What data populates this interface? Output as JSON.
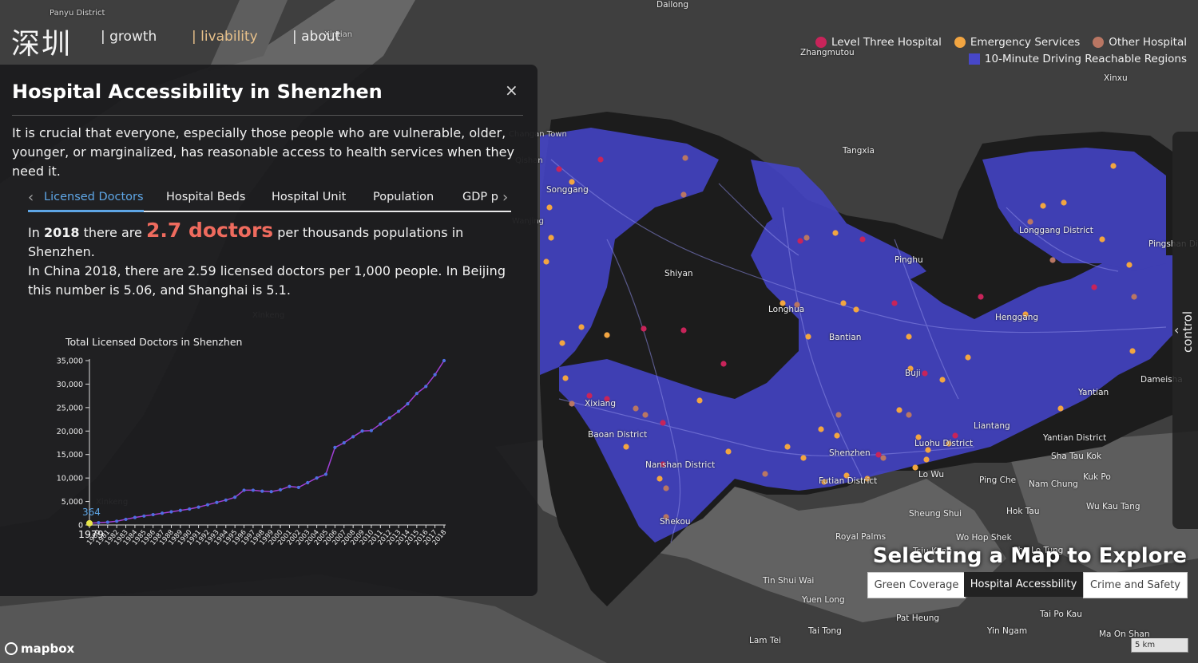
{
  "nav": {
    "logo": "深圳",
    "items": [
      {
        "label": "| growth",
        "active": false
      },
      {
        "label": "| livability",
        "active": true
      },
      {
        "label": "| about",
        "active": false
      }
    ]
  },
  "legend": {
    "items": [
      {
        "label": "Level Three Hospital",
        "color": "#c8245a"
      },
      {
        "label": "Emergency Services",
        "color": "#f2a541"
      },
      {
        "label": "Other Hospital",
        "color": "#b97663"
      }
    ],
    "region": {
      "label": "10-Minute Driving Reachable Regions",
      "color": "#4747c8"
    }
  },
  "map_labels": [
    {
      "text": "Panyu District"
    },
    {
      "text": "Dailong"
    },
    {
      "text": "Zhangmutou"
    },
    {
      "text": "Xinxu"
    },
    {
      "text": "Tangxia"
    },
    {
      "text": "Songgang"
    },
    {
      "text": "Longgang District"
    },
    {
      "text": "Pingshan Dist"
    },
    {
      "text": "Pinghu"
    },
    {
      "text": "Shiyan"
    },
    {
      "text": "Longhua"
    },
    {
      "text": "Bantian"
    },
    {
      "text": "Henggang"
    },
    {
      "text": "Buji"
    },
    {
      "text": "Yantian"
    },
    {
      "text": "Dameisha"
    },
    {
      "text": "Xixiang"
    },
    {
      "text": "Baoan District"
    },
    {
      "text": "Liantang"
    },
    {
      "text": "Yantian District"
    },
    {
      "text": "Luohu District"
    },
    {
      "text": "Shenzhen"
    },
    {
      "text": "Nanshan District"
    },
    {
      "text": "Sha Tau Kok"
    },
    {
      "text": "Futian District"
    },
    {
      "text": "Lo Wu"
    },
    {
      "text": "Ping Che"
    },
    {
      "text": "Nam Chung"
    },
    {
      "text": "Kuk Po"
    },
    {
      "text": "Shekou"
    },
    {
      "text": "Sheung Shui"
    },
    {
      "text": "Hok Tau"
    },
    {
      "text": "Wu Kau Tang"
    },
    {
      "text": "Royal Palms"
    },
    {
      "text": "Wo Hop Shek"
    },
    {
      "text": "Tsiu Keng"
    },
    {
      "text": "Sha Lo Tung"
    },
    {
      "text": "Tin Shui Wai"
    },
    {
      "text": "Yuen Long"
    },
    {
      "text": "Pat Heung"
    },
    {
      "text": "Tai Po Kau"
    },
    {
      "text": "Tai Tong"
    },
    {
      "text": "Yin Ngam"
    },
    {
      "text": "Ma On Shan"
    },
    {
      "text": "Lam Tei"
    },
    {
      "text": "Xinkeng"
    },
    {
      "text": "Changan Town"
    },
    {
      "text": "Xinkeng"
    },
    {
      "text": "Qishan"
    },
    {
      "text": "Wanjing"
    },
    {
      "text": "Xintian"
    }
  ],
  "panel": {
    "title": "Hospital Accessibility in Shenzhen",
    "close": "×",
    "intro": "It is crucial that everyone, especially those people who are vulnerable, older, younger, or marginalized, has reasonable access to health services when they need it.",
    "tabs": [
      "Licensed Doctors",
      "Hospital Beds",
      "Hospital Unit",
      "Population",
      "GDP p"
    ],
    "stat": {
      "p1": "In ",
      "year": "2018",
      "p2": " there are ",
      "value": "2.7 doctors",
      "p3": " per thousands populations in Shenzhen.",
      "p4": "In China 2018, there are 2.59 licensed doctors per 1,000 people. In Beijing this number is 5.06, and Shanghai is 5.1."
    }
  },
  "chart_data": {
    "type": "line",
    "title": "Total Licensed Doctors in Shenzhen",
    "x": [
      "1979",
      "1980",
      "1981",
      "1982",
      "1983",
      "1984",
      "1985",
      "1986",
      "1987",
      "1988",
      "1989",
      "1990",
      "1991",
      "1992",
      "1993",
      "1994",
      "1995",
      "1996",
      "1997",
      "1998",
      "1999",
      "2000",
      "2001",
      "2002",
      "2003",
      "2004",
      "2005",
      "2006",
      "2007",
      "2008",
      "2009",
      "2010",
      "2011",
      "2012",
      "2013",
      "2014",
      "2015",
      "2016",
      "2017",
      "2018"
    ],
    "values": [
      364,
      500,
      600,
      800,
      1200,
      1600,
      1900,
      2200,
      2500,
      2800,
      3100,
      3400,
      3800,
      4300,
      4800,
      5300,
      5900,
      7400,
      7400,
      7200,
      7100,
      7500,
      8200,
      8000,
      9000,
      10000,
      10800,
      16500,
      17500,
      18800,
      20000,
      20100,
      21500,
      22800,
      24200,
      25800,
      28000,
      29500,
      32000,
      35000
    ],
    "ylim": [
      0,
      35000
    ],
    "yticks": [
      "0",
      "5,000",
      "10,000",
      "15,000",
      "20,000",
      "25,000",
      "30,000",
      "35,000"
    ],
    "highlight": {
      "label": "364",
      "year": "1979"
    }
  },
  "control": {
    "label": "control",
    "chevron": "‹"
  },
  "selector": {
    "title": "Selecting a Map to Explore",
    "options": [
      {
        "label": "Green Coverage",
        "active": false
      },
      {
        "label": "Hospital Accessbility",
        "active": true
      },
      {
        "label": "Crime and Safety",
        "active": false
      }
    ]
  },
  "attribution": {
    "brand": "mapbox",
    "scale": "5 km"
  }
}
